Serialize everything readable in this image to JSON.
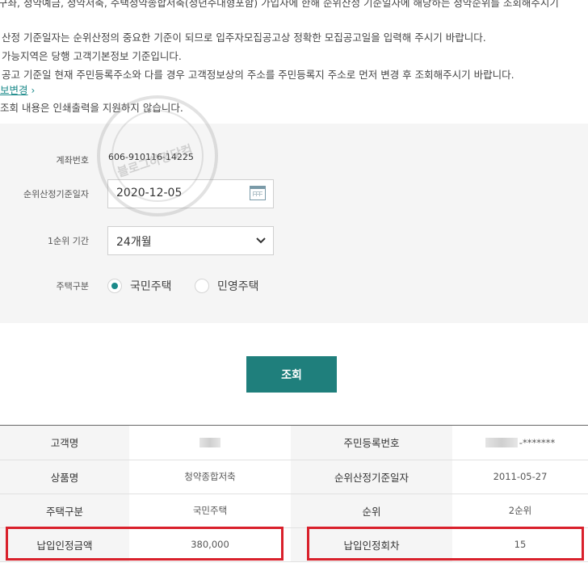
{
  "notices": {
    "line1": "구좌, 청약예금, 청약저축, 주택청약종합저축(청년주대형포함) 가입자에 한해 순위산정 기준일자에 해당하는 청약순위를 조회해주시기",
    "line2": "산정 기준일자는 순위산정의 중요한 기준이 되므로 입주자모집공고상 정확한 모집공고일을 입력해 주시기 바랍니다.",
    "line3": "가능지역은 당행 고객기본정보 기준입니다.",
    "line4": "공고 기준일 현재 주민등록주소와 다를 경우 고객정보상의 주소를 주민등록지 주소로 먼저 변경 후 조회해주시기 바랍니다.",
    "link": "보변경",
    "line6": "조회 내용은 인쇄출력을 지원하지 않습니다."
  },
  "watermark": {
    "text": "블로그하경닷컴"
  },
  "form": {
    "account_label": "계좌번호",
    "account_value": "606-910116-14225",
    "date_label": "순위산정기준일자",
    "date_value": "2020-12-05",
    "period_label": "1순위 기간",
    "period_value": "24개월",
    "type_label": "주택구분",
    "type_options": [
      "국민주택",
      "민영주택"
    ],
    "type_selected": "국민주택"
  },
  "actions": {
    "search": "조회"
  },
  "result": {
    "rows": [
      {
        "l1": "고객명",
        "v1": "",
        "l2": "주민등록번호",
        "v2": "-*******"
      },
      {
        "l1": "상품명",
        "v1": "청약종합저축",
        "l2": "순위산정기준일자",
        "v2": "2011-05-27"
      },
      {
        "l1": "주택구분",
        "v1": "국민주택",
        "l2": "순위",
        "v2": "2순위"
      },
      {
        "l1": "납입인정금액",
        "v1": "380,000",
        "l2": "납입인정회차",
        "v2": "15"
      }
    ]
  },
  "colors": {
    "accent": "#1f7f7c",
    "highlight": "#d9202b",
    "panel": "#f5f5f5"
  }
}
